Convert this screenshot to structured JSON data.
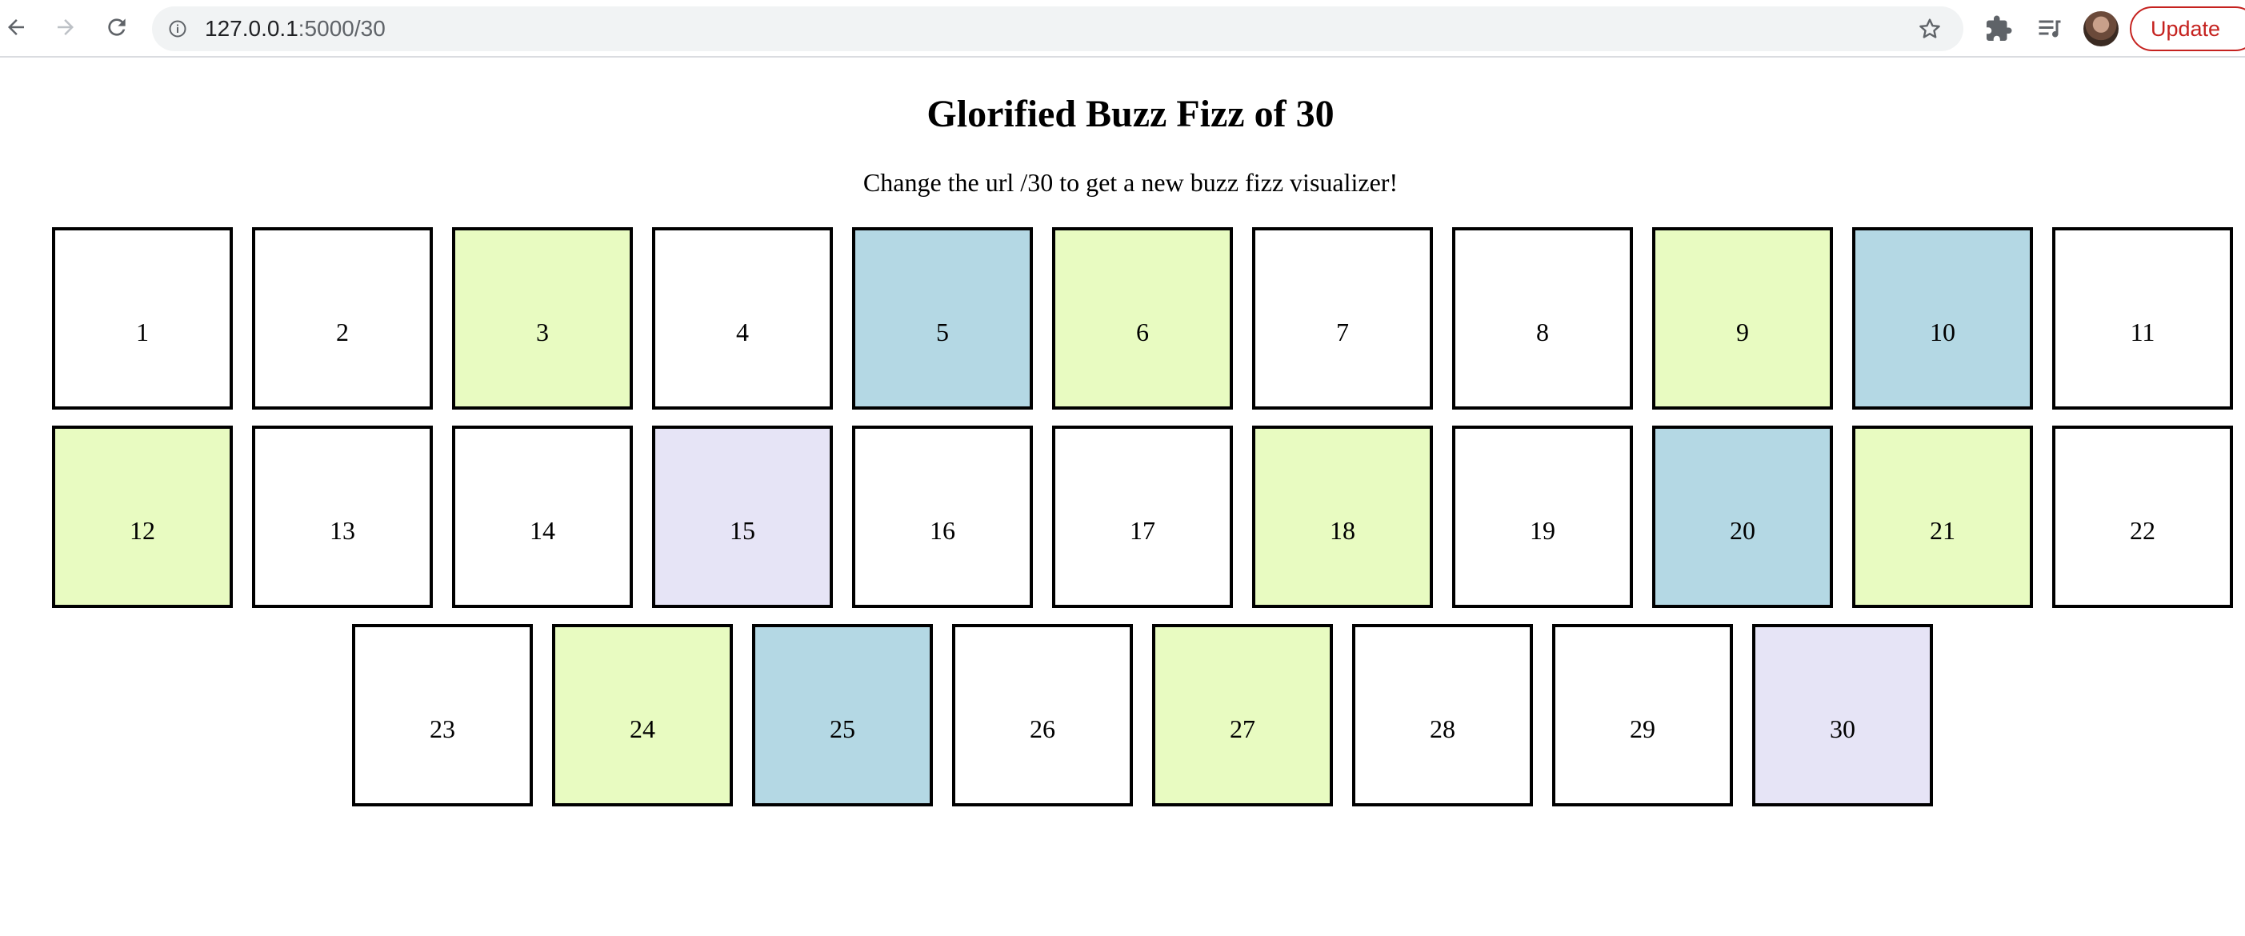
{
  "browser": {
    "url_host": "127.0.0.1",
    "url_path": ":5000/30",
    "update_label": "Update"
  },
  "page": {
    "title": "Glorified Buzz Fizz of 30",
    "subtitle": "Change the url /30 to get a new buzz fizz visualizer!"
  },
  "colors": {
    "fizz": "#e8fbc1",
    "buzz": "#b4d8e4",
    "fizzbuzz": "#e6e4f6",
    "plain": "#ffffff"
  },
  "cells": [
    {
      "label": "1",
      "kind": "plain"
    },
    {
      "label": "2",
      "kind": "plain"
    },
    {
      "label": "3",
      "kind": "fizz"
    },
    {
      "label": "4",
      "kind": "plain"
    },
    {
      "label": "5",
      "kind": "buzz"
    },
    {
      "label": "6",
      "kind": "fizz"
    },
    {
      "label": "7",
      "kind": "plain"
    },
    {
      "label": "8",
      "kind": "plain"
    },
    {
      "label": "9",
      "kind": "fizz"
    },
    {
      "label": "10",
      "kind": "buzz"
    },
    {
      "label": "11",
      "kind": "plain"
    },
    {
      "label": "12",
      "kind": "fizz"
    },
    {
      "label": "13",
      "kind": "plain"
    },
    {
      "label": "14",
      "kind": "plain"
    },
    {
      "label": "15",
      "kind": "fizzbuzz"
    },
    {
      "label": "16",
      "kind": "plain"
    },
    {
      "label": "17",
      "kind": "plain"
    },
    {
      "label": "18",
      "kind": "fizz"
    },
    {
      "label": "19",
      "kind": "plain"
    },
    {
      "label": "20",
      "kind": "buzz"
    },
    {
      "label": "21",
      "kind": "fizz"
    },
    {
      "label": "22",
      "kind": "plain"
    },
    {
      "label": "23",
      "kind": "plain"
    },
    {
      "label": "24",
      "kind": "fizz"
    },
    {
      "label": "25",
      "kind": "buzz"
    },
    {
      "label": "26",
      "kind": "plain"
    },
    {
      "label": "27",
      "kind": "fizz"
    },
    {
      "label": "28",
      "kind": "plain"
    },
    {
      "label": "29",
      "kind": "plain"
    },
    {
      "label": "30",
      "kind": "fizzbuzz"
    }
  ]
}
